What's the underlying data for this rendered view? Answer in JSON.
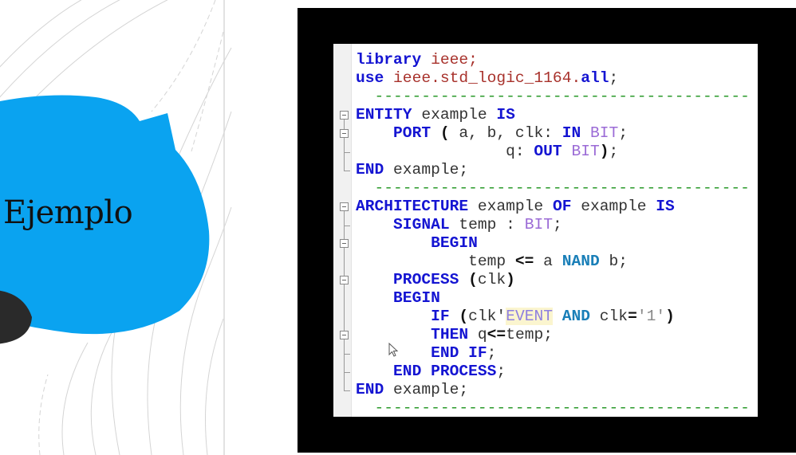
{
  "slide": {
    "title": "Ejemplo",
    "colors": {
      "blob": "#0aa3f0",
      "dark_blob": "#2a2a2a"
    }
  },
  "editor": {
    "language": "VHDL",
    "lines": [
      [
        [
          "kw",
          "library"
        ],
        [
          "plain",
          " "
        ],
        [
          "lib",
          "ieee;"
        ]
      ],
      [
        [
          "kw",
          "use"
        ],
        [
          "plain",
          " "
        ],
        [
          "lib",
          "ieee.std_logic_1164."
        ],
        [
          "kw",
          "all"
        ],
        [
          "plain",
          ";"
        ]
      ],
      [
        [
          "cmt",
          "  ----------------------------------------"
        ]
      ],
      [
        [
          "kw",
          "ENTITY"
        ],
        [
          "plain",
          " example "
        ],
        [
          "kw",
          "IS"
        ]
      ],
      [
        [
          "plain",
          "    "
        ],
        [
          "kw",
          "PORT"
        ],
        [
          "plain",
          " "
        ],
        [
          "op",
          "("
        ],
        [
          "plain",
          " a, b, clk: "
        ],
        [
          "kw",
          "IN"
        ],
        [
          "plain",
          " "
        ],
        [
          "type",
          "BIT"
        ],
        [
          "plain",
          ";"
        ]
      ],
      [
        [
          "plain",
          "                q: "
        ],
        [
          "kw",
          "OUT"
        ],
        [
          "plain",
          " "
        ],
        [
          "type",
          "BIT"
        ],
        [
          "op",
          ")"
        ],
        [
          "plain",
          ";"
        ]
      ],
      [
        [
          "kw",
          "END"
        ],
        [
          "plain",
          " example;"
        ]
      ],
      [
        [
          "cmt",
          "  ----------------------------------------"
        ]
      ],
      [
        [
          "kw",
          "ARCHITECTURE"
        ],
        [
          "plain",
          " example "
        ],
        [
          "kw",
          "OF"
        ],
        [
          "plain",
          " example "
        ],
        [
          "kw",
          "IS"
        ]
      ],
      [
        [
          "plain",
          "    "
        ],
        [
          "kw",
          "SIGNAL"
        ],
        [
          "plain",
          " temp : "
        ],
        [
          "type",
          "BIT"
        ],
        [
          "plain",
          ";"
        ]
      ],
      [
        [
          "plain",
          "        "
        ],
        [
          "kw",
          "BEGIN"
        ]
      ],
      [
        [
          "plain",
          "            temp "
        ],
        [
          "op",
          "<="
        ],
        [
          "plain",
          " a "
        ],
        [
          "logic",
          "NAND"
        ],
        [
          "plain",
          " b;"
        ]
      ],
      [
        [
          "plain",
          "    "
        ],
        [
          "kw",
          "PROCESS"
        ],
        [
          "plain",
          " "
        ],
        [
          "op",
          "("
        ],
        [
          "plain",
          "clk"
        ],
        [
          "op",
          ")"
        ]
      ],
      [
        [
          "plain",
          "    "
        ],
        [
          "kw",
          "BEGIN"
        ]
      ],
      [
        [
          "plain",
          "        "
        ],
        [
          "kw",
          "IF"
        ],
        [
          "plain",
          " "
        ],
        [
          "op",
          "("
        ],
        [
          "plain",
          "clk'"
        ],
        [
          "attr",
          "EVENT"
        ],
        [
          "plain",
          " "
        ],
        [
          "logic",
          "AND"
        ],
        [
          "plain",
          " clk"
        ],
        [
          "op",
          "="
        ],
        [
          "str",
          "'1'"
        ],
        [
          "op",
          ")"
        ]
      ],
      [
        [
          "plain",
          "        "
        ],
        [
          "kw",
          "THEN"
        ],
        [
          "plain",
          " q"
        ],
        [
          "op",
          "<="
        ],
        [
          "plain",
          "temp;"
        ]
      ],
      [
        [
          "plain",
          "        "
        ],
        [
          "kw",
          "END"
        ],
        [
          "plain",
          " "
        ],
        [
          "kw",
          "IF"
        ],
        [
          "plain",
          ";"
        ]
      ],
      [
        [
          "plain",
          "    "
        ],
        [
          "kw",
          "END"
        ],
        [
          "plain",
          " "
        ],
        [
          "kw",
          "PROCESS"
        ],
        [
          "plain",
          ";"
        ]
      ],
      [
        [
          "kw",
          "END"
        ],
        [
          "plain",
          " example;"
        ]
      ],
      [
        [
          "cmt",
          "  ----------------------------------------"
        ]
      ]
    ]
  }
}
